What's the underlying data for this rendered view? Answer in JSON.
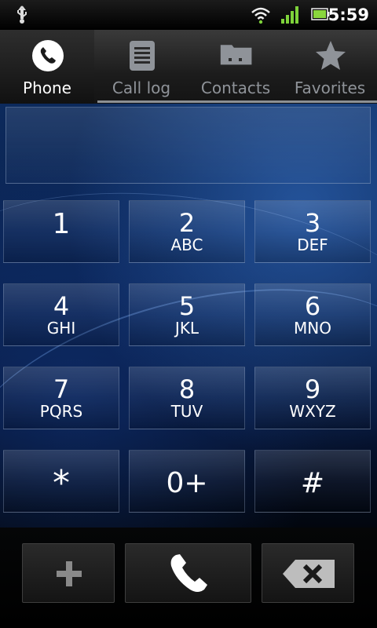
{
  "status": {
    "time": "5:59",
    "icons": [
      "usb-icon",
      "wifi-icon",
      "signal-icon",
      "battery-icon"
    ]
  },
  "tabs": [
    {
      "label": "Phone",
      "icon": "phone-icon",
      "active": true
    },
    {
      "label": "Call log",
      "icon": "call-log-icon",
      "active": false
    },
    {
      "label": "Contacts",
      "icon": "contacts-icon",
      "active": false
    },
    {
      "label": "Favorites",
      "icon": "star-icon",
      "active": false
    }
  ],
  "display": {
    "value": ""
  },
  "keypad": [
    {
      "digit": "1",
      "letters": ""
    },
    {
      "digit": "2",
      "letters": "ABC"
    },
    {
      "digit": "3",
      "letters": "DEF"
    },
    {
      "digit": "4",
      "letters": "GHI"
    },
    {
      "digit": "5",
      "letters": "JKL"
    },
    {
      "digit": "6",
      "letters": "MNO"
    },
    {
      "digit": "7",
      "letters": "PQRS"
    },
    {
      "digit": "8",
      "letters": "TUV"
    },
    {
      "digit": "9",
      "letters": "WXYZ"
    },
    {
      "digit": "*",
      "letters": ""
    },
    {
      "digit": "0+",
      "letters": ""
    },
    {
      "digit": "#",
      "letters": ""
    }
  ],
  "bottom": {
    "add_icon": "plus-icon",
    "call_icon": "phone-icon",
    "delete_icon": "backspace-icon"
  },
  "colors": {
    "accent": "#1d4a9a",
    "tab_inactive": "#8f9399",
    "tab_active": "#ffffff"
  }
}
